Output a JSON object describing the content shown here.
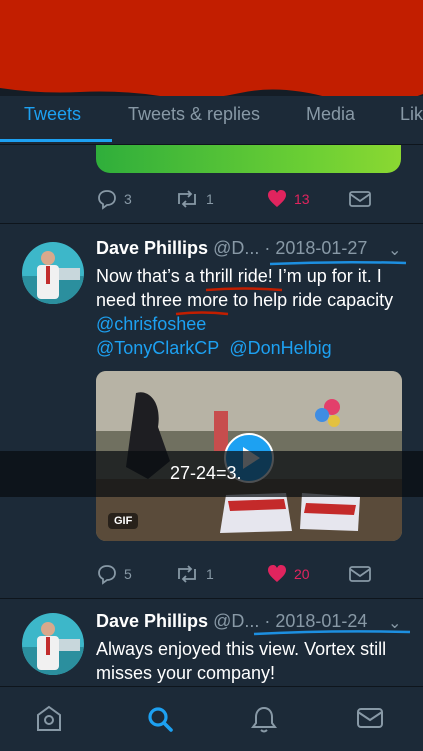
{
  "tabs": [
    {
      "label": "Tweets",
      "active": true
    },
    {
      "label": "Tweets & replies",
      "active": false
    },
    {
      "label": "Media",
      "active": false
    },
    {
      "label": "Lik",
      "active": false
    }
  ],
  "prev_tweet": {
    "replies": "3",
    "retweets": "1",
    "likes": "13"
  },
  "tweets": [
    {
      "name": "Dave Phillips",
      "handle": "@D...",
      "date": " · 2018-01-27",
      "text_parts": [
        "Now that’s a thrill ride!  I’m up for it. I need three more to help ride capacity "
      ],
      "mentions": [
        "@chrisfoshee",
        "@TonyClarkCP",
        "@DonHelbig"
      ],
      "media_badge": "GIF",
      "replies": "5",
      "retweets": "1",
      "likes": "20"
    },
    {
      "name": "Dave Phillips",
      "handle": "@D...",
      "date": " · 2018-01-24",
      "text": "Always enjoyed this view. Vortex still misses your company!"
    }
  ],
  "overlay_text": "27-24=3.",
  "nav": [
    "home-icon",
    "search-icon",
    "notifications-icon",
    "messages-icon"
  ],
  "colors": {
    "accent": "#1da1f2",
    "like": "#e0245e",
    "annotation_red": "#c21e00",
    "annotation_blue": "#1d8fe0"
  }
}
